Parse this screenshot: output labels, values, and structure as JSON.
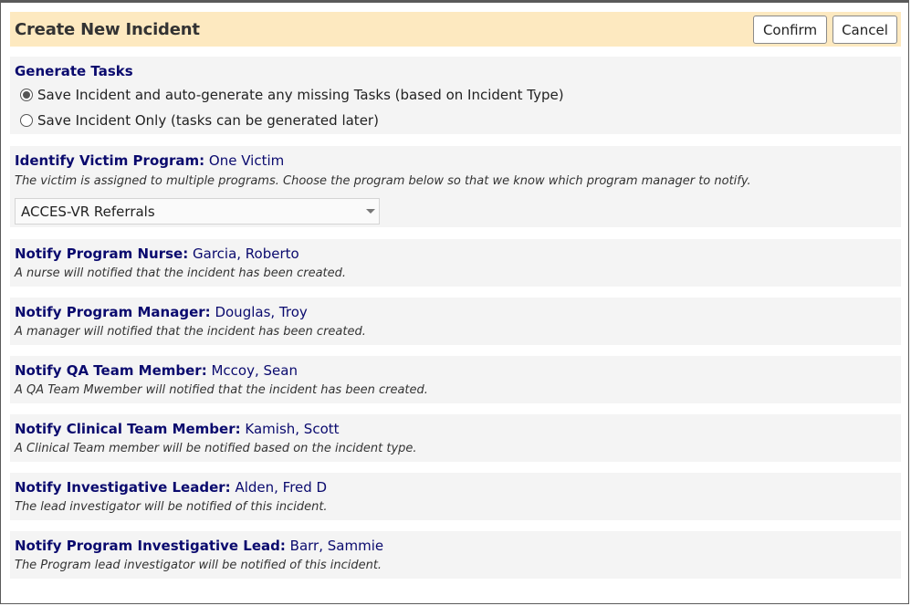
{
  "dialog": {
    "title": "Create New Incident",
    "confirm_label": "Confirm",
    "cancel_label": "Cancel"
  },
  "generate_tasks": {
    "title": "Generate Tasks",
    "options": [
      {
        "label": "Save Incident and auto-generate any missing Tasks (based on Incident Type)",
        "selected": true
      },
      {
        "label": "Save Incident Only (tasks can be generated later)",
        "selected": false
      }
    ]
  },
  "victim_program": {
    "label": "Identify Victim Program:",
    "value": "One Victim",
    "description": "The victim is assigned to multiple programs. Choose the program below so that we know which program manager to notify.",
    "selected_program": "ACCES-VR Referrals"
  },
  "notifications": [
    {
      "label": "Notify Program Nurse:",
      "value": "Garcia, Roberto",
      "description": "A nurse will notified that the incident has been created."
    },
    {
      "label": "Notify Program Manager:",
      "value": "Douglas, Troy",
      "description": "A manager will notified that the incident has been created."
    },
    {
      "label": "Notify QA Team Member:",
      "value": "Mccoy, Sean",
      "description": "A QA Team Mwember will notified that the incident has been created."
    },
    {
      "label": "Notify Clinical Team Member:",
      "value": "Kamish, Scott",
      "description": "A Clinical Team member will be notified based on the incident type."
    },
    {
      "label": "Notify Investigative Leader:",
      "value": "Alden, Fred D",
      "description": "The lead investigator will be notified of this incident."
    },
    {
      "label": "Notify Program Investigative Lead:",
      "value": "Barr, Sammie",
      "description": "The Program lead investigator will be notified of this incident."
    }
  ]
}
